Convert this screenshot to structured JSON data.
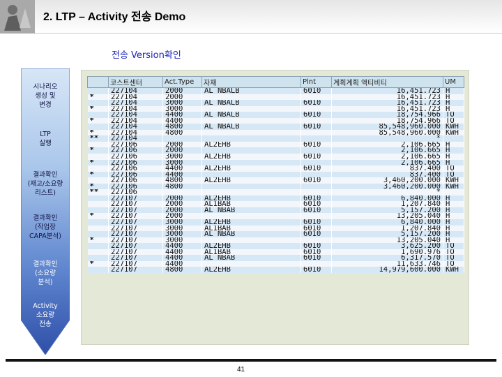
{
  "header": {
    "title": "2. LTP – Activity 전송 Demo"
  },
  "subtitle": "전송 Version확인",
  "steps": [
    {
      "label_lines": [
        "시나리오",
        "생성 및",
        "변경"
      ]
    },
    {
      "label_lines": [
        "LTP",
        "실행"
      ]
    },
    {
      "label_lines": [
        "결과확인",
        "(재고/소요량",
        "리스트)"
      ]
    },
    {
      "label_lines": [
        "결과확인",
        "(작업장",
        "CAPA분석)"
      ]
    },
    {
      "label_lines": [
        "결과확인",
        "(소요량",
        "분석)"
      ]
    },
    {
      "label_lines": [
        "Activity",
        "소요량",
        "전송"
      ]
    }
  ],
  "table": {
    "columns": [
      "",
      "코스트센터",
      "Act.Type",
      "자재",
      "Plnt",
      "계획계획 액티비티",
      "UM"
    ],
    "rows": [
      [
        "",
        "227104",
        "2000",
        "AL NBALB",
        "6010",
        "16,451.723",
        "H"
      ],
      [
        "*",
        "227104",
        "2000",
        "",
        "",
        "16,451.723",
        "H"
      ],
      [
        "",
        "227104",
        "3000",
        "AL NBALB",
        "6010",
        "16,451.723",
        "H"
      ],
      [
        "*",
        "227104",
        "3000",
        "",
        "",
        "16,451.723",
        "H"
      ],
      [
        "",
        "227104",
        "4400",
        "AL NBALB",
        "6010",
        "18,754.966",
        "TO"
      ],
      [
        "*",
        "227104",
        "4400",
        "",
        "",
        "18,754.966",
        "TO"
      ],
      [
        "",
        "227104",
        "4800",
        "AL NBALB",
        "6010",
        "85,548,960.000",
        "KWH"
      ],
      [
        "*",
        "227104",
        "4800",
        "",
        "",
        "85,548,960.000",
        "KWH"
      ],
      [
        "**",
        "227104",
        "",
        "",
        "",
        "*",
        ""
      ],
      [
        "",
        "227106",
        "2000",
        "AL2EHB",
        "6010",
        "2,106.665",
        "H"
      ],
      [
        "*",
        "227106",
        "2000",
        "",
        "",
        "2,106.665",
        "H"
      ],
      [
        "",
        "227106",
        "3000",
        "AL2EHB",
        "6010",
        "2,106.665",
        "H"
      ],
      [
        "*",
        "227106",
        "3000",
        "",
        "",
        "2,106.665",
        "H"
      ],
      [
        "",
        "227106",
        "4400",
        "AL2EHB",
        "6010",
        "837.400",
        "TO"
      ],
      [
        "*",
        "227106",
        "4400",
        "",
        "",
        "837.400",
        "TO"
      ],
      [
        "",
        "227106",
        "4800",
        "AL2EHB",
        "6010",
        "3,460,200.000",
        "KWH"
      ],
      [
        "*",
        "227106",
        "4800",
        "",
        "",
        "3,460,200.000",
        "KWH"
      ],
      [
        "**",
        "227106",
        "",
        "",
        "",
        "*",
        ""
      ],
      [
        "",
        "227107",
        "2000",
        "AL2EHB",
        "6010",
        "6,840.000",
        "H"
      ],
      [
        "",
        "227107",
        "2000",
        "AL1BAB",
        "6010",
        "1,207.840",
        "H"
      ],
      [
        "",
        "227107",
        "2000",
        "AL NBAB",
        "6010",
        "5,157.200",
        "H"
      ],
      [
        "*",
        "227107",
        "2000",
        "",
        "",
        "13,205.040",
        "H"
      ],
      [
        "",
        "227107",
        "3000",
        "AL2EHB",
        "6010",
        "6,840.000",
        "H"
      ],
      [
        "",
        "227107",
        "3000",
        "AL1BAB",
        "6010",
        "1,207.840",
        "H"
      ],
      [
        "",
        "227107",
        "3000",
        "AL NBAB",
        "6010",
        "5,157.200",
        "H"
      ],
      [
        "*",
        "227107",
        "3000",
        "",
        "",
        "13,205.040",
        "H"
      ],
      [
        "",
        "227107",
        "4400",
        "AL2EHB",
        "6010",
        "3,625.200",
        "TO"
      ],
      [
        "",
        "227107",
        "4400",
        "AL1BAB",
        "6010",
        "1,690.976",
        "TO"
      ],
      [
        "",
        "227107",
        "4400",
        "AL NBAB",
        "6010",
        "6,317.570",
        "TO"
      ],
      [
        "*",
        "227107",
        "4400",
        "",
        "",
        "11,633.746",
        "TO"
      ],
      [
        "",
        "227107",
        "4800",
        "AL2EHB",
        "6010",
        "14,979,600.000",
        "KWH"
      ]
    ]
  },
  "footer": {
    "page_number": "41"
  }
}
